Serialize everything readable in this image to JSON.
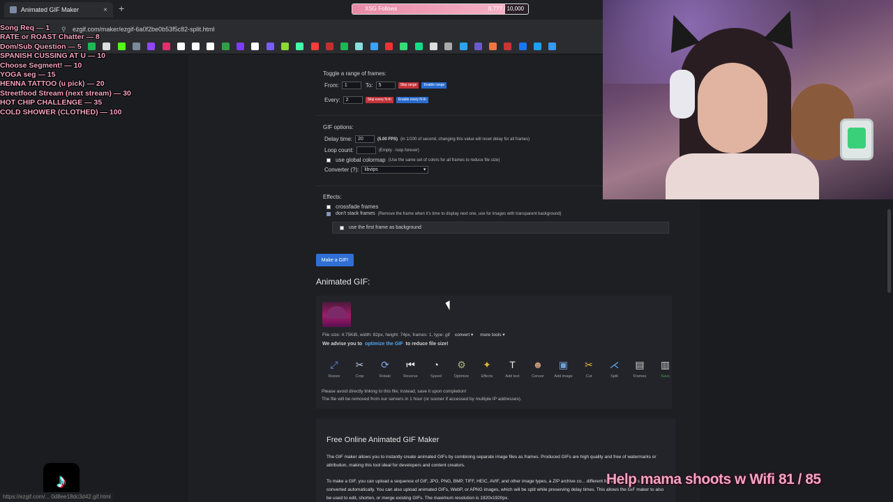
{
  "browser": {
    "tab_title": "Animated GIF Maker",
    "tab_close": "×",
    "new_tab": "+",
    "url": "ezgif.com/maker/ezgif-6a0f2be0b53f5c82-split.html",
    "status_url": "https://ezgif.com/... 0d8ee18dc3d42.gif.html"
  },
  "overlay": {
    "goal_label": "XSG Follows",
    "goal_current": "8,7??",
    "goal_target": "/ 10,000",
    "goal_progress": 0.87,
    "menu": [
      "Song Req — 1",
      "RATE or ROAST Chatter — 8",
      "Dom/Sub Question — 5",
      "SPANISH CUSSING AT U — 10",
      "Choose Segment! — 10",
      "YOGA seg — 15",
      "HENNA TATTOO (u pick) — 20",
      "Streetfood Stream (next stream) — 30",
      "HOT CHIP CHALLENGE — 35",
      "COLD SHOWER (CLOTHED) — 100"
    ],
    "wifi_caption": "Help mama shoots w Wifi  81 / 85"
  },
  "frames": {
    "toggle_heading": "Toggle a range of frames:",
    "from_label": "From:",
    "from_value": "1",
    "to_label": "To:",
    "to_value": "5",
    "skip_range": "Skip range",
    "enable_range": "Enable range",
    "every_label": "Every:",
    "every_value": "2",
    "skip_every": "Skip every N-th",
    "enable_every": "Enable every N-th"
  },
  "gif_options": {
    "heading": "GIF options:",
    "delay_label": "Delay time:",
    "delay_value": "20",
    "delay_fps": "(5.00 FPS)",
    "delay_note": "(in 1/100 of second, changing this value will reset delay for all frames)",
    "loop_label": "Loop count:",
    "loop_value": "",
    "loop_note": "(Empty - loop forever)",
    "global_colormap": "use global colormap",
    "global_colormap_note": "(Use the same set of colors for all frames to reduce file size)",
    "converter_label": "Converter (?):",
    "converter_value": "libvips"
  },
  "effects": {
    "heading": "Effects:",
    "crossfade": "crossfade frames",
    "dont_stack": "don't stack frames",
    "dont_stack_note": "(Remove the frame when it's time to display next one, use for images with transparent background)",
    "first_frame_bg": "use the first frame as background"
  },
  "make_button": "Make a GIF!",
  "animated_title": "Animated GIF:",
  "file_info": {
    "text": "File size: 4.75KiB, width: 82px, height: 74px, frames: 1, type: gif",
    "convert": "convert ▾",
    "more_tools": "more tools ▾",
    "advise_prefix": "We advise you to",
    "advise_link": "optimize the GIF",
    "advise_suffix": "to reduce file size!"
  },
  "tools": [
    {
      "label": "Resize",
      "icon": "resize-icon",
      "glyph": "⤢",
      "color": "#6c8fd8"
    },
    {
      "label": "Crop",
      "icon": "crop-icon",
      "glyph": "✂",
      "color": "#b9c7d8"
    },
    {
      "label": "Rotate",
      "icon": "rotate-icon",
      "glyph": "⟳",
      "color": "#7fa3e0"
    },
    {
      "label": "Reverse",
      "icon": "reverse-icon",
      "glyph": "⏮",
      "color": "#e6e6e6"
    },
    {
      "label": "Speed",
      "icon": "speed-icon",
      "glyph": "◔",
      "color": "#dcdcdc"
    },
    {
      "label": "Optimize",
      "icon": "optimize-icon",
      "glyph": "⚙",
      "color": "#a8b46a"
    },
    {
      "label": "Effects",
      "icon": "effects-icon",
      "glyph": "✦",
      "color": "#e3b62a"
    },
    {
      "label": "Add text",
      "icon": "add-text-icon",
      "glyph": "T",
      "color": "#e9e9e9"
    },
    {
      "label": "Censor",
      "icon": "censor-icon",
      "glyph": "☻",
      "color": "#c79a7a"
    },
    {
      "label": "Add image",
      "icon": "add-image-icon",
      "glyph": "▣",
      "color": "#6fa0d8"
    },
    {
      "label": "Cut",
      "icon": "cut-icon",
      "glyph": "✂",
      "color": "#e2b53a"
    },
    {
      "label": "Split",
      "icon": "split-icon",
      "glyph": "⋌",
      "color": "#5aa6e8"
    },
    {
      "label": "Frames",
      "icon": "frames-icon",
      "glyph": "▤",
      "color": "#d8d8d8"
    },
    {
      "label": "Save",
      "icon": "save-icon",
      "glyph": "▥",
      "color": "#cfcfcf"
    }
  ],
  "notices": {
    "line1": "Please avoid directly linking to this file; instead, save it upon completion!",
    "line2": "The file will be removed from our servers in 1 hour (or sooner if accessed by multiple IP addresses)."
  },
  "info": {
    "title": "Free Online Animated GIF Maker",
    "p1": "The GIF maker allows you to instantly create animated GIFs by combining separate image files as frames. Produced GIFs are high quality and free of watermarks or attribution, making this tool ideal for developers and content creators.",
    "p2": "To make a GIF, you can upload a sequence of GIF, JPG, PNG, BMP, TIFF, HEIC, AVIF, and other image types, a ZIP archive co... different formats and sizes - they will be converted automatically. You can also upload animated GIFs, WebP, or APNG images, which will be split while preserving delay times. This allows the GIF maker to also be used to edit, shorten, or merge existing GIFs. The maximum resolution is 1920x1920px."
  },
  "bookmark_colors": [
    "#1db954",
    "#ddd",
    "#53fc18",
    "#7b8a9a",
    "#9146ff",
    "#e1306c",
    "#fff",
    "#fff",
    "#fff",
    "#2ea043",
    "#7d3cff",
    "#ffffff",
    "#7a5cff",
    "#8bd932",
    "#4fa",
    "#ff3b3b",
    "#c4302b",
    "#1db954",
    "#8dd",
    "#3ba0ff",
    "#e33",
    "#3d7",
    "#1d8",
    "#ddd",
    "#aaa",
    "#2aa4f4",
    "#6a5acd",
    "#e74",
    "#c33",
    "#1877f2",
    "#1da1f2",
    "#39f"
  ]
}
